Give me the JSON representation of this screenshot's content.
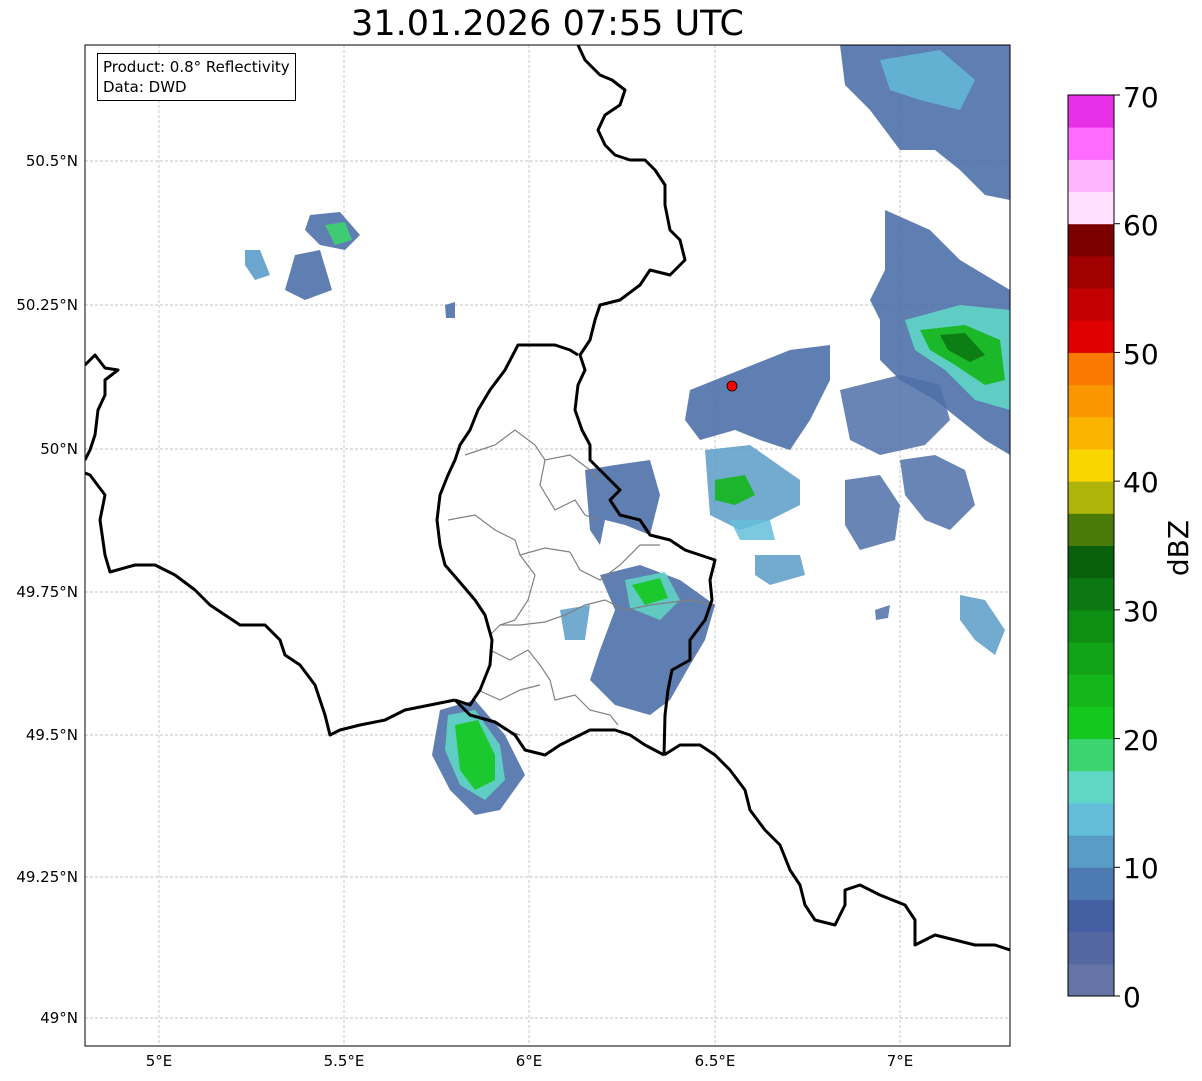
{
  "title": "31.01.2026 07:55 UTC",
  "info": {
    "product": "Product: 0.8° Reflectivity",
    "source": "Data: DWD"
  },
  "axes": {
    "lat_ticks": [
      "50.5°N",
      "50.25°N",
      "50°N",
      "49.75°N",
      "49.5°N",
      "49.25°N",
      "49°N"
    ],
    "lon_ticks": [
      "5°E",
      "5.5°E",
      "6°E",
      "6.5°E",
      "7°E"
    ]
  },
  "colorbar": {
    "label": "dBZ",
    "tick_labels": [
      "0",
      "10",
      "20",
      "30",
      "40",
      "50",
      "60",
      "70"
    ],
    "min": 0,
    "max": 70,
    "colors": [
      "#6475a6",
      "#5567a0",
      "#4460a2",
      "#4e7ab2",
      "#5a9cc8",
      "#64bedb",
      "#60d6c6",
      "#3cd46e",
      "#14c81e",
      "#14b61a",
      "#12a416",
      "#0e8e12",
      "#0b7812",
      "#08600c",
      "#4a7a0a",
      "#aeb40a",
      "#fad600",
      "#fab400",
      "#fa9600",
      "#fa7a00",
      "#e00000",
      "#c40000",
      "#a00000",
      "#7a0000",
      "#ffe0ff",
      "#ffb4ff",
      "#ff6aff",
      "#e830e8"
    ]
  },
  "radar_marker": {
    "color": "#ff0000"
  },
  "colors": {
    "border": "#000000",
    "subdivision": "#808080",
    "grid": "#b0b0b0"
  }
}
